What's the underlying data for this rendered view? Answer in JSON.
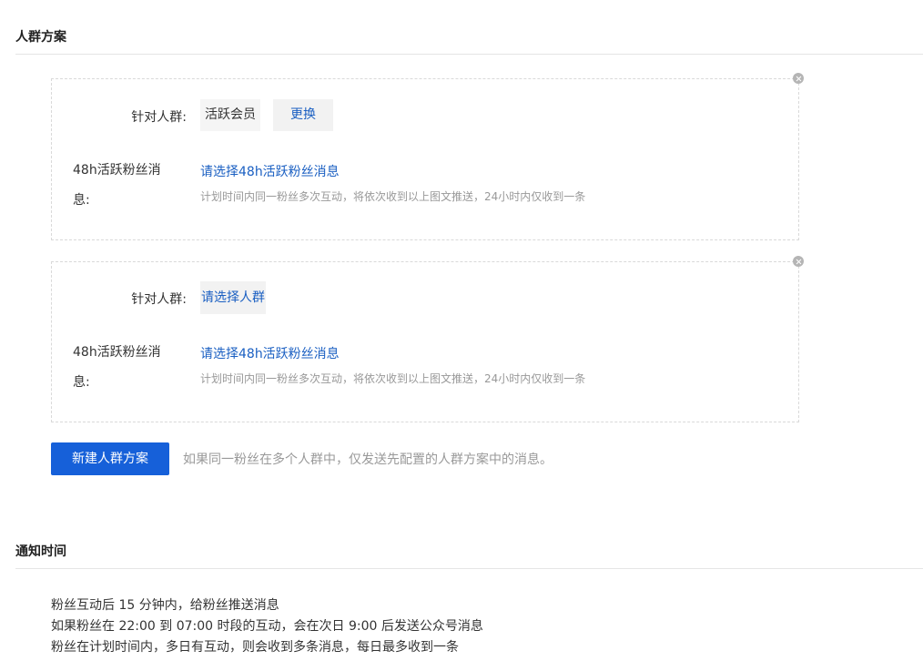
{
  "audience_section": {
    "title": "人群方案",
    "plans": [
      {
        "audience_label": "针对人群:",
        "audience_value": "活跃会员",
        "change_label": "更换",
        "message_label_line1": "48h活跃粉丝消",
        "message_label_line2": "息:",
        "message_link": "请选择48h活跃粉丝消息",
        "message_hint": "计划时间内同一粉丝多次互动，将依次收到以上图文推送，24小时内仅收到一条"
      },
      {
        "audience_label": "针对人群:",
        "audience_link": "请选择人群",
        "message_label_line1": "48h活跃粉丝消",
        "message_label_line2": "息:",
        "message_link": "请选择48h活跃粉丝消息",
        "message_hint": "计划时间内同一粉丝多次互动，将依次收到以上图文推送，24小时内仅收到一条"
      }
    ],
    "new_button_label": "新建人群方案",
    "new_button_tip": "如果同一粉丝在多个人群中，仅发送先配置的人群方案中的消息。"
  },
  "notify_section": {
    "title": "通知时间",
    "lines": [
      "粉丝互动后 15 分钟内，给粉丝推送消息",
      "如果粉丝在 22:00 到 07:00 时段的互动，会在次日 9:00 后发送公众号消息",
      "粉丝在计划时间内，多日有互动，则会收到多条消息，每日最多收到一条"
    ]
  },
  "colors": {
    "primary": "#1660d9",
    "link": "#1a5fc2",
    "hint": "#999999"
  }
}
